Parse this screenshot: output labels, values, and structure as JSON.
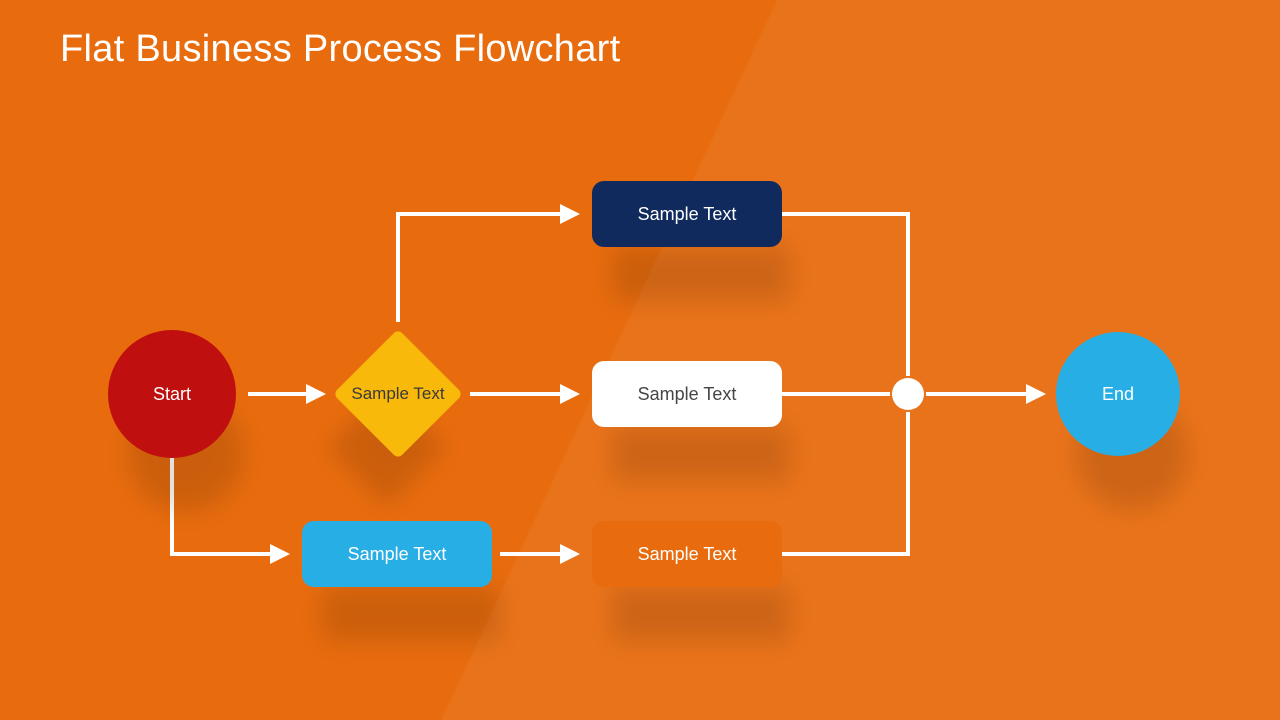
{
  "title": "Flat Business Process Flowchart",
  "nodes": {
    "start": "Start",
    "decision": "Sample Text",
    "proc_navy": "Sample Text",
    "proc_white": "Sample Text",
    "proc_cyan": "Sample Text",
    "proc_orange": "Sample Text",
    "end": "End"
  },
  "colors": {
    "background": "#E86C0E",
    "start": "#BF0F0F",
    "decision": "#F8B90B",
    "proc_navy": "#102A5E",
    "proc_white": "#FFFFFF",
    "proc_cyan": "#27AEE5",
    "proc_orange": "#E86C0E",
    "end": "#27AEE5",
    "connector": "#FFFFFF"
  }
}
